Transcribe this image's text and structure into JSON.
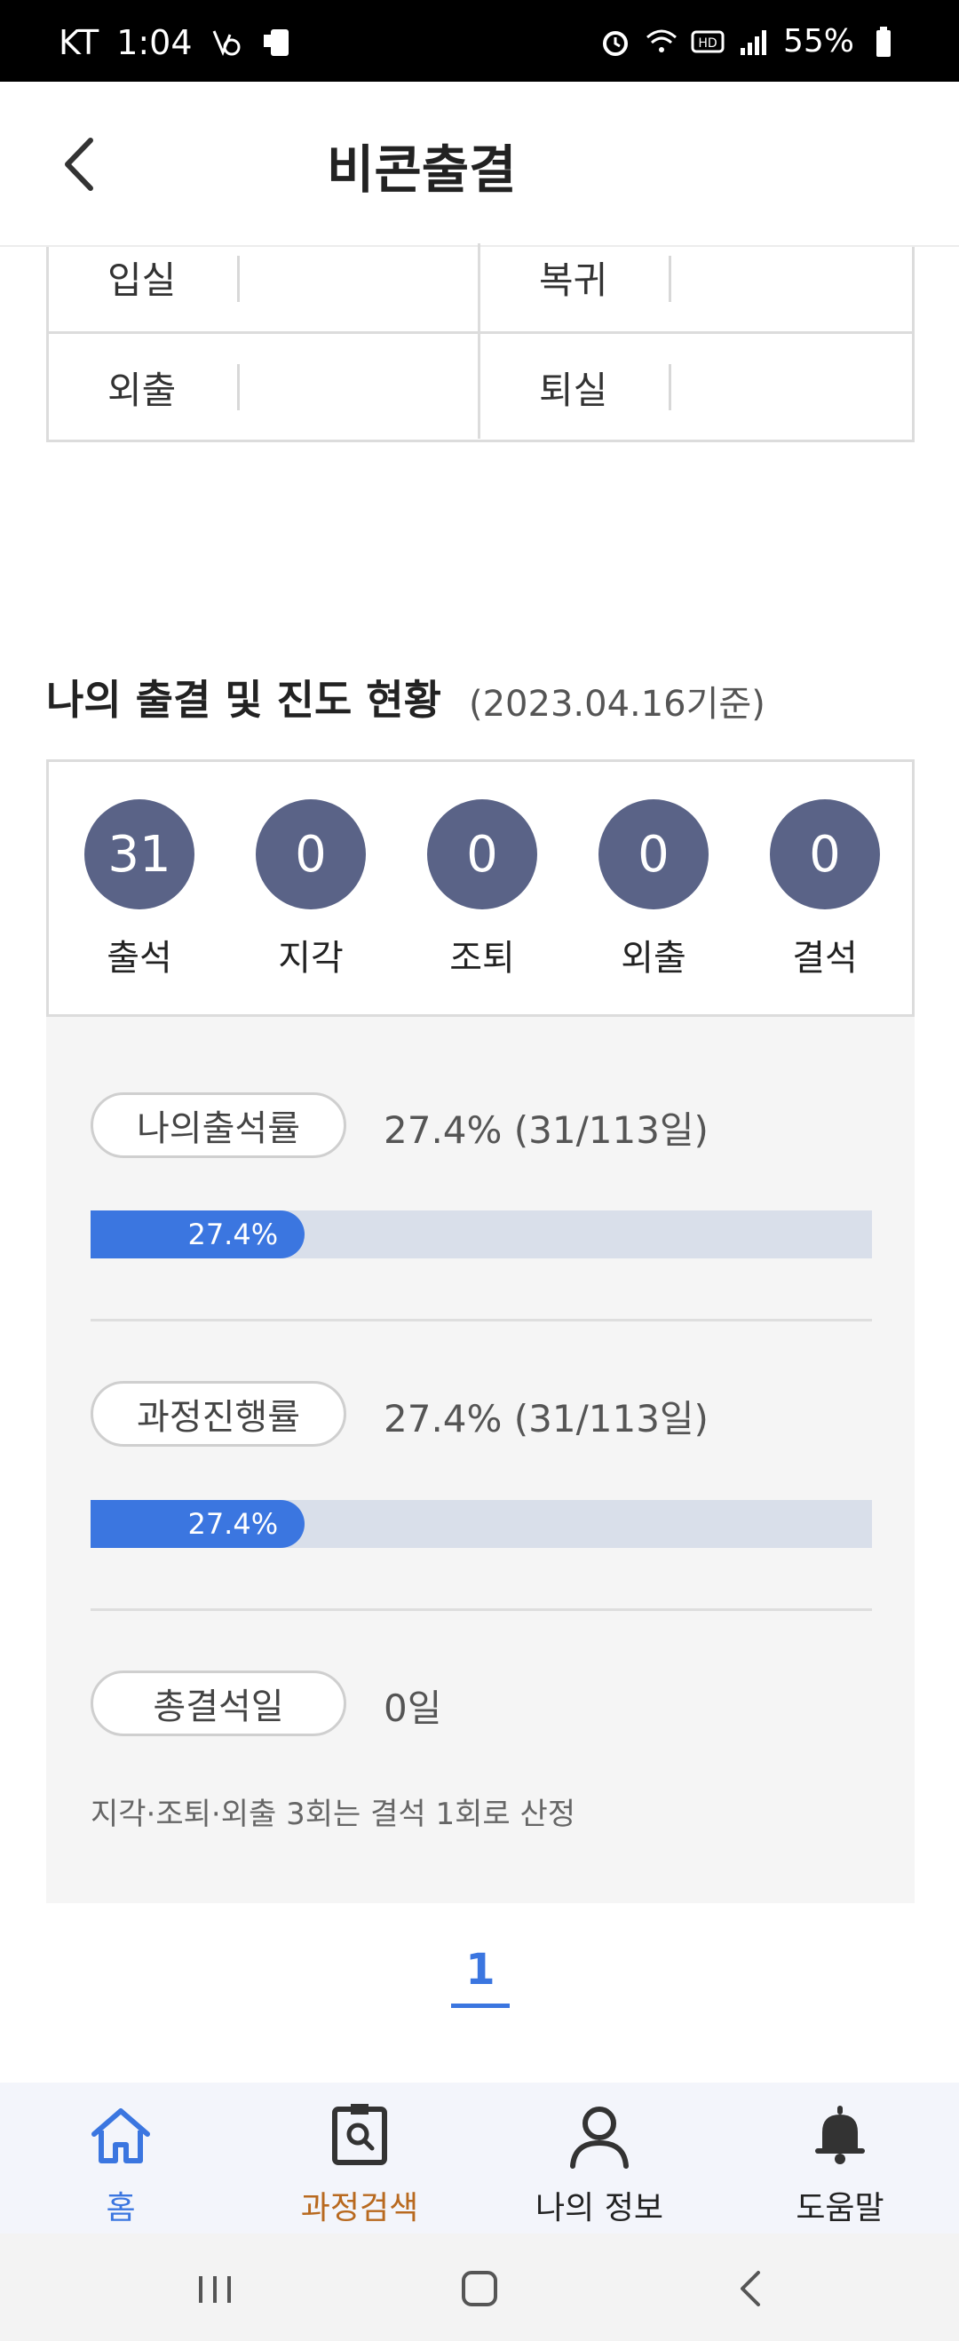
{
  "status_bar": {
    "carrier": "KT",
    "time": "1:04",
    "battery": "55%"
  },
  "header": {
    "title": "비콘출결"
  },
  "io_table": {
    "entry": "입실",
    "return": "복귀",
    "out": "외출",
    "exit": "퇴실"
  },
  "section": {
    "title": "나의 출결 및 진도 현황",
    "as_of": "(2023.04.16기준)"
  },
  "attendance": [
    {
      "label": "출석",
      "count": "31"
    },
    {
      "label": "지각",
      "count": "0"
    },
    {
      "label": "조퇴",
      "count": "0"
    },
    {
      "label": "외출",
      "count": "0"
    },
    {
      "label": "결석",
      "count": "0"
    }
  ],
  "progress": {
    "attendance_rate": {
      "label": "나의출석률",
      "text": "27.4% (31/113일)",
      "bar_label": "27.4%",
      "value_pct": 27.4
    },
    "course_progress": {
      "label": "과정진행률",
      "text": "27.4% (31/113일)",
      "bar_label": "27.4%",
      "value_pct": 27.4
    },
    "total_absence": {
      "label": "총결석일",
      "text": "0일"
    },
    "note": "지각·조퇴·외출 3회는 결석 1회로 산정"
  },
  "pagination": {
    "current": "1"
  },
  "bottom_nav": {
    "items": [
      {
        "label": "홈",
        "color": "#3b76e0"
      },
      {
        "label": "과정검색",
        "color": "#b8691f"
      },
      {
        "label": "나의 정보",
        "color": "#222222"
      },
      {
        "label": "도움말",
        "color": "#222222"
      }
    ]
  },
  "colors": {
    "accent": "#3b76e0",
    "circle": "#5a6387",
    "bar_track": "#d9dfea"
  }
}
